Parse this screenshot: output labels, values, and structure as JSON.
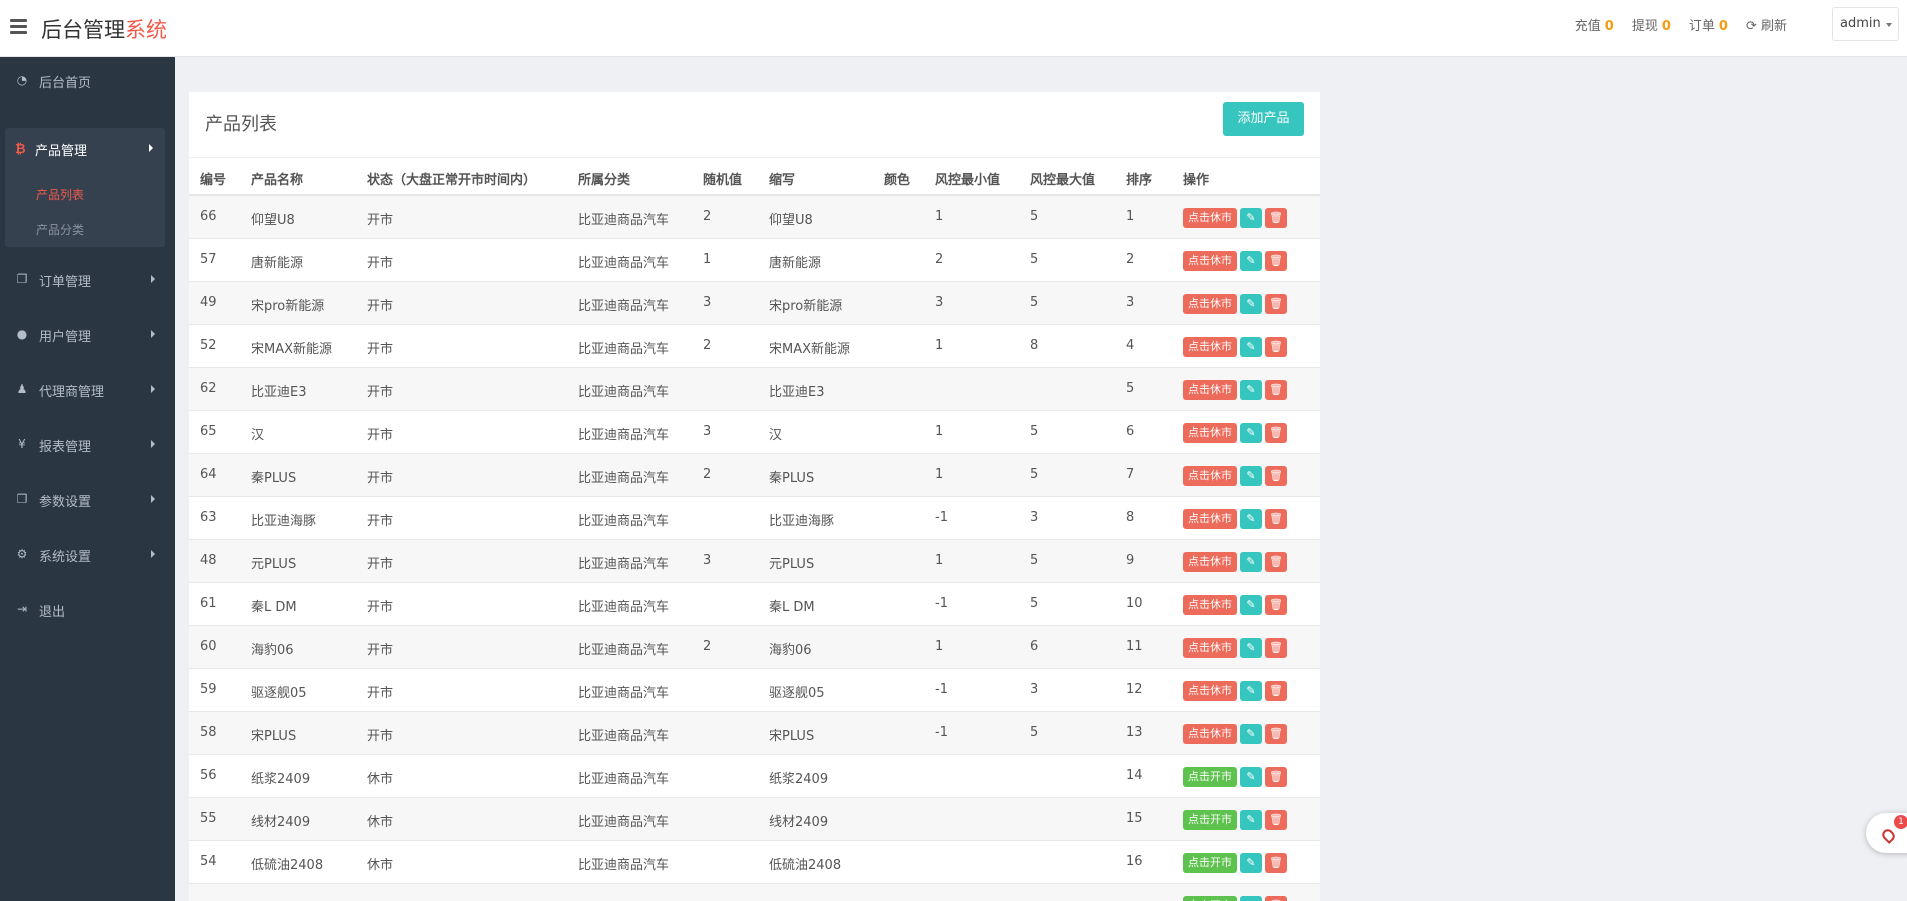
{
  "header": {
    "brand_main": "后台管理",
    "brand_accent": "系统",
    "nav": [
      {
        "label": "充值",
        "count": "0"
      },
      {
        "label": "提现",
        "count": "0"
      },
      {
        "label": "订单",
        "count": "0"
      }
    ],
    "refresh_label": "刷新",
    "user": "admin"
  },
  "sidebar": {
    "home": "后台首页",
    "product_group": "产品管理",
    "product_sub": [
      "产品列表",
      "产品分类"
    ],
    "items": [
      "订单管理",
      "用户管理",
      "代理商管理",
      "报表管理",
      "参数设置",
      "系统设置"
    ],
    "logout": "退出"
  },
  "panel": {
    "title": "产品列表",
    "add_button": "添加产品"
  },
  "table": {
    "columns": [
      "编号",
      "产品名称",
      "状态（大盘正常开市时间内）",
      "所属分类",
      "随机值",
      "缩写",
      "颜色",
      "风控最小值",
      "风控最大值",
      "排序",
      "操作"
    ],
    "rows": [
      {
        "id": "66",
        "name": "仰望U8",
        "status": "开市",
        "cat": "比亚迪商品汽车",
        "rand": "2",
        "abbr": "仰望U8",
        "color": "",
        "min": "1",
        "max": "5",
        "sort": "1",
        "action": "点击休市",
        "open": true
      },
      {
        "id": "57",
        "name": "唐新能源",
        "status": "开市",
        "cat": "比亚迪商品汽车",
        "rand": "1",
        "abbr": "唐新能源",
        "color": "",
        "min": "2",
        "max": "5",
        "sort": "2",
        "action": "点击休市",
        "open": true
      },
      {
        "id": "49",
        "name": "宋pro新能源",
        "status": "开市",
        "cat": "比亚迪商品汽车",
        "rand": "3",
        "abbr": "宋pro新能源",
        "color": "",
        "min": "3",
        "max": "5",
        "sort": "3",
        "action": "点击休市",
        "open": true
      },
      {
        "id": "52",
        "name": "宋MAX新能源",
        "status": "开市",
        "cat": "比亚迪商品汽车",
        "rand": "2",
        "abbr": "宋MAX新能源",
        "color": "",
        "min": "1",
        "max": "8",
        "sort": "4",
        "action": "点击休市",
        "open": true
      },
      {
        "id": "62",
        "name": "比亚迪E3",
        "status": "开市",
        "cat": "比亚迪商品汽车",
        "rand": "",
        "abbr": "比亚迪E3",
        "color": "",
        "min": "",
        "max": "",
        "sort": "5",
        "action": "点击休市",
        "open": true
      },
      {
        "id": "65",
        "name": "汉",
        "status": "开市",
        "cat": "比亚迪商品汽车",
        "rand": "3",
        "abbr": "汉",
        "color": "",
        "min": "1",
        "max": "5",
        "sort": "6",
        "action": "点击休市",
        "open": true
      },
      {
        "id": "64",
        "name": "秦PLUS",
        "status": "开市",
        "cat": "比亚迪商品汽车",
        "rand": "2",
        "abbr": "秦PLUS",
        "color": "",
        "min": "1",
        "max": "5",
        "sort": "7",
        "action": "点击休市",
        "open": true
      },
      {
        "id": "63",
        "name": "比亚迪海豚",
        "status": "开市",
        "cat": "比亚迪商品汽车",
        "rand": "",
        "abbr": "比亚迪海豚",
        "color": "",
        "min": "-1",
        "max": "3",
        "sort": "8",
        "action": "点击休市",
        "open": true
      },
      {
        "id": "48",
        "name": "元PLUS",
        "status": "开市",
        "cat": "比亚迪商品汽车",
        "rand": "3",
        "abbr": "元PLUS",
        "color": "",
        "min": "1",
        "max": "5",
        "sort": "9",
        "action": "点击休市",
        "open": true
      },
      {
        "id": "61",
        "name": "秦L DM",
        "status": "开市",
        "cat": "比亚迪商品汽车",
        "rand": "",
        "abbr": "秦L DM",
        "color": "",
        "min": "-1",
        "max": "5",
        "sort": "10",
        "action": "点击休市",
        "open": true
      },
      {
        "id": "60",
        "name": "海豹06",
        "status": "开市",
        "cat": "比亚迪商品汽车",
        "rand": "2",
        "abbr": "海豹06",
        "color": "",
        "min": "1",
        "max": "6",
        "sort": "11",
        "action": "点击休市",
        "open": true
      },
      {
        "id": "59",
        "name": "驱逐舰05",
        "status": "开市",
        "cat": "比亚迪商品汽车",
        "rand": "",
        "abbr": "驱逐舰05",
        "color": "",
        "min": "-1",
        "max": "3",
        "sort": "12",
        "action": "点击休市",
        "open": true
      },
      {
        "id": "58",
        "name": "宋PLUS",
        "status": "开市",
        "cat": "比亚迪商品汽车",
        "rand": "",
        "abbr": "宋PLUS",
        "color": "",
        "min": "-1",
        "max": "5",
        "sort": "13",
        "action": "点击休市",
        "open": true
      },
      {
        "id": "56",
        "name": "纸浆2409",
        "status": "休市",
        "cat": "比亚迪商品汽车",
        "rand": "",
        "abbr": "纸浆2409",
        "color": "",
        "min": "",
        "max": "",
        "sort": "14",
        "action": "点击开市",
        "open": false
      },
      {
        "id": "55",
        "name": "线材2409",
        "status": "休市",
        "cat": "比亚迪商品汽车",
        "rand": "",
        "abbr": "线材2409",
        "color": "",
        "min": "",
        "max": "",
        "sort": "15",
        "action": "点击开市",
        "open": false
      },
      {
        "id": "54",
        "name": "低硫油2408",
        "status": "休市",
        "cat": "比亚迪商品汽车",
        "rand": "",
        "abbr": "低硫油2408",
        "color": "",
        "min": "",
        "max": "",
        "sort": "16",
        "action": "点击开市",
        "open": false
      },
      {
        "id": "",
        "name": "",
        "status": "",
        "cat": "",
        "rand": "",
        "abbr": "",
        "color": "",
        "min": "",
        "max": "",
        "sort": "",
        "action": "点击开市",
        "open": false
      }
    ]
  },
  "float_widget": {
    "badge": "1"
  },
  "colors": {
    "accent": "#f05a4a",
    "teal": "#36c6bf",
    "green": "#5ec34e",
    "sidebar": "#2b3643"
  }
}
